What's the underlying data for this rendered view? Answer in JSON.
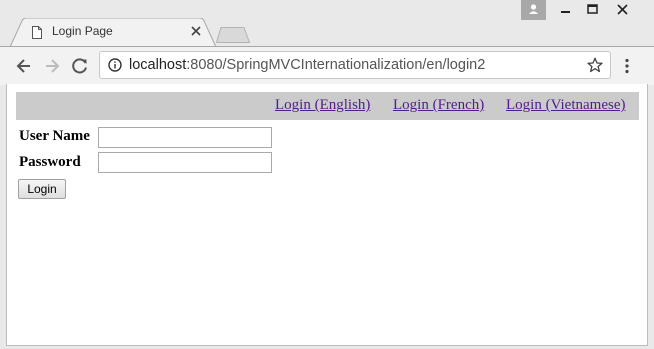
{
  "browser": {
    "tab_title": "Login Page",
    "url_host": "localhost",
    "url_rest": ":8080/SpringMVCInternationalization/en/login2"
  },
  "lang_links": {
    "english": "Login (English)",
    "french": "Login (French)",
    "vietnamese": "Login (Vietnamese)"
  },
  "form": {
    "username_label": "User Name",
    "password_label": "Password",
    "username_value": "",
    "password_value": "",
    "login_button": "Login"
  },
  "colors": {
    "lang_bar": "#cbcbcb",
    "visited_link": "#551a8b"
  }
}
